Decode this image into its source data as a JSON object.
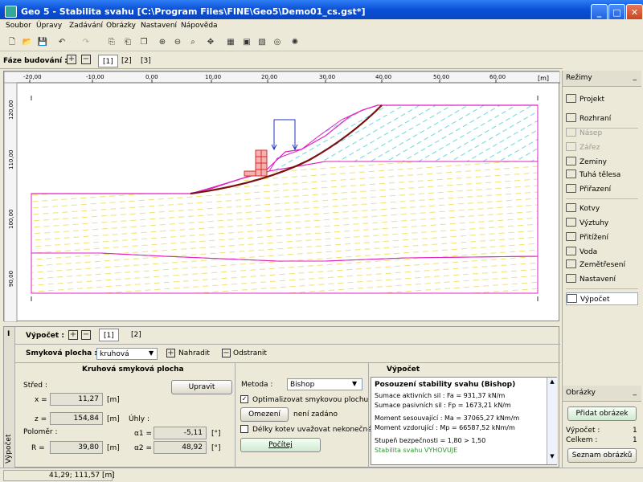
{
  "window": {
    "title": "Geo 5 - Stabilita svahu [C:\\Program Files\\FINE\\Geo5\\Demo01_cs.gst*]"
  },
  "menu": [
    "Soubor",
    "Úpravy",
    "Zadávání",
    "Obrázky",
    "Nastavení",
    "Nápověda"
  ],
  "stages": {
    "label": "Fáze budování :",
    "tabs": [
      "[1]",
      "[2]",
      "[3]"
    ],
    "selected": 0
  },
  "ruler": {
    "x_ticks": [
      "-20,00",
      "-10,00",
      "0,00",
      "10,00",
      "20,00",
      "30,00",
      "40,00",
      "50,00",
      "60,00"
    ],
    "unit": "[m]",
    "y_ticks": [
      "120,00",
      "110,00",
      "100,00",
      "90,00"
    ]
  },
  "bottom": {
    "label": "Výpočet :",
    "tabs": [
      "[1]",
      "[2]"
    ],
    "slip_label": "Smyková plocha :",
    "slip_value": "kruhová",
    "replace_label": "Nahradit",
    "remove_label": "Odstranit",
    "left_title": "Kruhová smyková plocha",
    "edit_button": "Upravit",
    "center_label": "Střed :",
    "x_label": "x =",
    "x_value": "11,27",
    "z_label": "z =",
    "z_value": "154,84",
    "unit_m": "[m]",
    "radius_label": "Poloměr :",
    "r_label": "R =",
    "r_value": "39,80",
    "angles_label": "Úhly :",
    "a1_label": "α1 =",
    "a1_value": "-5,11",
    "a2_label": "α2 =",
    "a2_value": "48,92",
    "unit_deg": "[°]",
    "method_label": "Metoda :",
    "method_value": "Bishop",
    "optimize_label": "Optimalizovat smykovou plochu",
    "limit_button": "Omezení",
    "limit_value": "není zadáno",
    "anchors_label": "Délky kotev uvažovat nekonečné",
    "calc_button": "Počítej",
    "result_title": "Výpočet",
    "results": [
      "Posouzení stability svahu (Bishop)",
      "Sumace aktivních sil :  Fa =     931,37  kN/m",
      "Sumace pasivních sil :  Fp =   1673,21  kN/m",
      "Moment sesouvající :  Ma = 37065,27  kNm/m",
      "Moment vzdorující :    Mp = 66587,52  kNm/m",
      "Stupeň bezpečnosti = 1,80 > 1,50",
      "Stabilita svahu VYHOVUJE"
    ],
    "side_tab": "Výpočet"
  },
  "right": {
    "modes_title": "Režimy",
    "items": [
      {
        "label": "Projekt",
        "enabled": true
      },
      {
        "label": "Rozhraní",
        "enabled": true
      },
      {
        "label": "Násep",
        "enabled": false
      },
      {
        "label": "Zářez",
        "enabled": false
      },
      {
        "label": "Zeminy",
        "enabled": true
      },
      {
        "label": "Tuhá tělesa",
        "enabled": true
      },
      {
        "label": "Přiřazení",
        "enabled": true
      },
      {
        "label": "Kotvy",
        "enabled": true
      },
      {
        "label": "Výztuhy",
        "enabled": true
      },
      {
        "label": "Přitížení",
        "enabled": true
      },
      {
        "label": "Voda",
        "enabled": true
      },
      {
        "label": "Zemětřesení",
        "enabled": true
      },
      {
        "label": "Nastavení",
        "enabled": true
      },
      {
        "label": "Výpočet",
        "enabled": true
      }
    ],
    "images_title": "Obrázky",
    "add_image": "Přidat obrázek",
    "calc_label": "Výpočet :",
    "calc_count": "1",
    "total_label": "Celkem :",
    "total_count": "1",
    "list_images": "Seznam obrázků"
  },
  "status": {
    "coords": "41,29; 111,57 [m]"
  },
  "colors": {
    "accent": "#0a4fd6",
    "ok": "#2a9a2a",
    "boundary": "#e020c0",
    "slip": "#7a1010"
  }
}
